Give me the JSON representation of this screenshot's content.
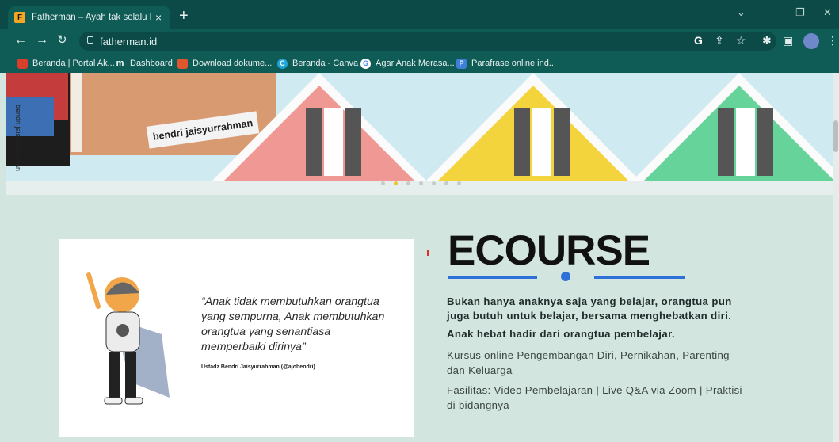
{
  "browser": {
    "tab_title": "Fatherman – Ayah tak selalu hadi",
    "favicon_letter": "F",
    "new_tab": "+",
    "url": "fatherman.id",
    "bookmarks": [
      "Beranda | Portal Ak...",
      "Dashboard",
      "Download dokume...",
      "Beranda - Canva",
      "Agar Anak Merasa...",
      "Parafrase online ind..."
    ]
  },
  "banner": {
    "book_author": "bendri jaisyurrahman",
    "book_spine": "bendri jaisyurrahman",
    "slide_count": 7,
    "active_slide": 2
  },
  "quote_card": {
    "quote": "“Anak tidak membutuhkan orangtua yang sempurna, Anak membutuhkan orangtua yang senantiasa memperbaiki dirinya”",
    "author": "Ustadz Bendri Jaisyurrahman (@ajobendri)"
  },
  "ecourse": {
    "heading": "ECOURSE",
    "bold_text_1": "Bukan hanya anaknya saja yang belajar, orangtua pun juga butuh untuk belajar, bersama menghebatkan diri.",
    "bold_text_2": "Anak hebat hadir dari orangtua pembelajar.",
    "courses": "Kursus online Pengembangan Diri, Pernikahan, Parenting dan Keluarga",
    "facilities": "Fasilitas: Video Pembelajaran | Live Q&A via Zoom | Praktisi di bidangnya"
  },
  "colors": {
    "chrome": "#0f5b56",
    "page_bg": "#d3e5df",
    "accent_blue": "#2f6fd8",
    "active_dot": "#e9c431"
  }
}
